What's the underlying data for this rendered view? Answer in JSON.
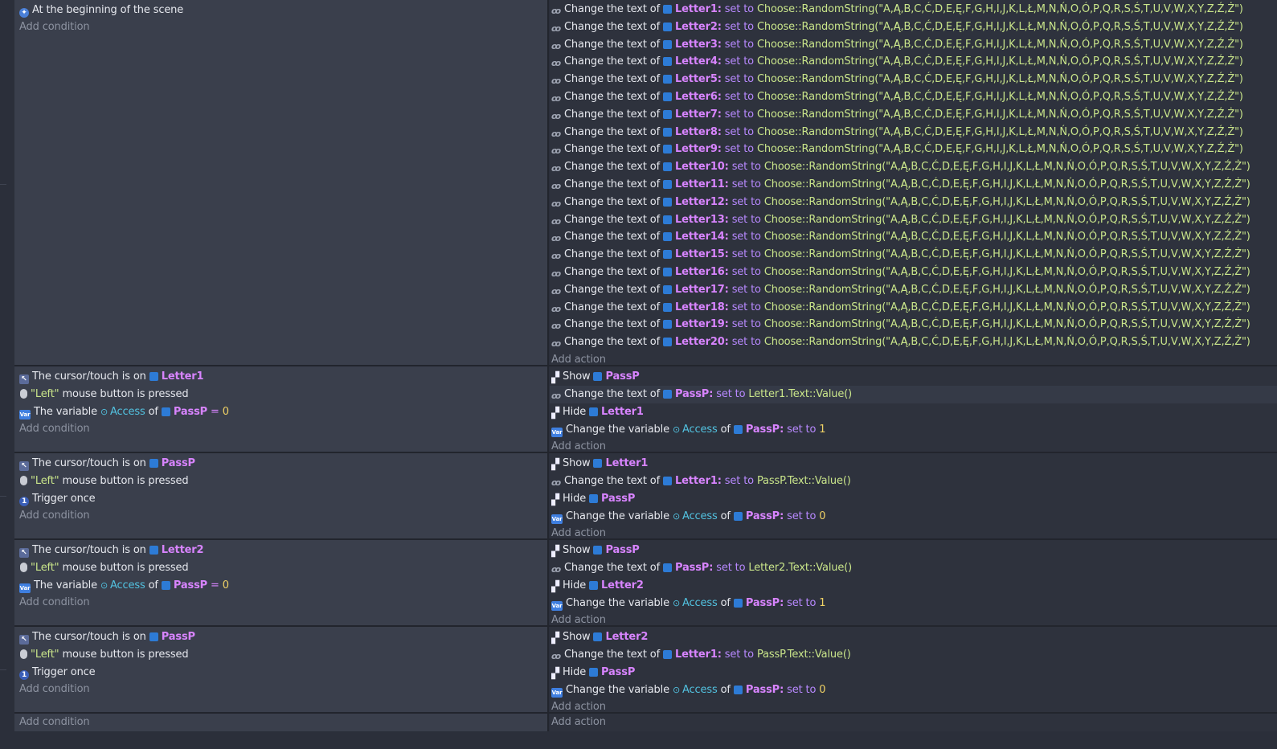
{
  "add_condition": "Add condition",
  "add_action": "Add action",
  "event1": {
    "condition": "At the beginning of the scene",
    "actions": [
      {
        "obj": "Letter1"
      },
      {
        "obj": "Letter2"
      },
      {
        "obj": "Letter3"
      },
      {
        "obj": "Letter4"
      },
      {
        "obj": "Letter5"
      },
      {
        "obj": "Letter6"
      },
      {
        "obj": "Letter7"
      },
      {
        "obj": "Letter8"
      },
      {
        "obj": "Letter9"
      },
      {
        "obj": "Letter10"
      },
      {
        "obj": "Letter11"
      },
      {
        "obj": "Letter12"
      },
      {
        "obj": "Letter13"
      },
      {
        "obj": "Letter14"
      },
      {
        "obj": "Letter15"
      },
      {
        "obj": "Letter16"
      },
      {
        "obj": "Letter17"
      },
      {
        "obj": "Letter18"
      },
      {
        "obj": "Letter19"
      },
      {
        "obj": "Letter20"
      }
    ],
    "change_text_prefix": "Change the text of",
    "set_to": "set to",
    "random_expr": "Choose::RandomString(\"A,Ą,B,C,Ć,D,E,Ę,F,G,H,I,J,K,L,Ł,M,N,Ń,O,Ó,P,Q,R,S,Ś,T,U,V,W,X,Y,Z,Ź,Ż\")"
  },
  "labels": {
    "cursor_on": "The cursor/touch is on",
    "left": "\"Left\"",
    "mouse_pressed": "mouse button is pressed",
    "the_variable": "The variable",
    "access": "Access",
    "of": "of",
    "eq": "=",
    "trigger_once": "Trigger once",
    "show": "Show",
    "hide": "Hide",
    "change_text": "Change the text of",
    "change_var": "Change the variable",
    "set_to": "set to"
  },
  "event2": {
    "cursor_obj": "Letter1",
    "var_obj": "PassP",
    "var_val": "0",
    "show_obj": "PassP",
    "text_obj": "PassP",
    "text_expr": "Letter1.Text::Value()",
    "hide_obj": "Letter1",
    "setvar_obj": "PassP",
    "setvar_val": "1"
  },
  "event3": {
    "cursor_obj": "PassP",
    "show_obj": "Letter1",
    "text_obj": "Letter1",
    "text_expr": "PassP.Text::Value()",
    "hide_obj": "PassP",
    "setvar_obj": "PassP",
    "setvar_val": "0"
  },
  "event4": {
    "cursor_obj": "Letter2",
    "var_obj": "PassP",
    "var_val": "0",
    "show_obj": "PassP",
    "text_obj": "PassP",
    "text_expr": "Letter2.Text::Value()",
    "hide_obj": "Letter2",
    "setvar_obj": "PassP",
    "setvar_val": "1"
  },
  "event5": {
    "cursor_obj": "PassP",
    "show_obj": "Letter2",
    "text_obj": "Letter1",
    "text_expr": "PassP.Text::Value()",
    "hide_obj": "PassP",
    "setvar_obj": "PassP",
    "setvar_val": "0"
  }
}
